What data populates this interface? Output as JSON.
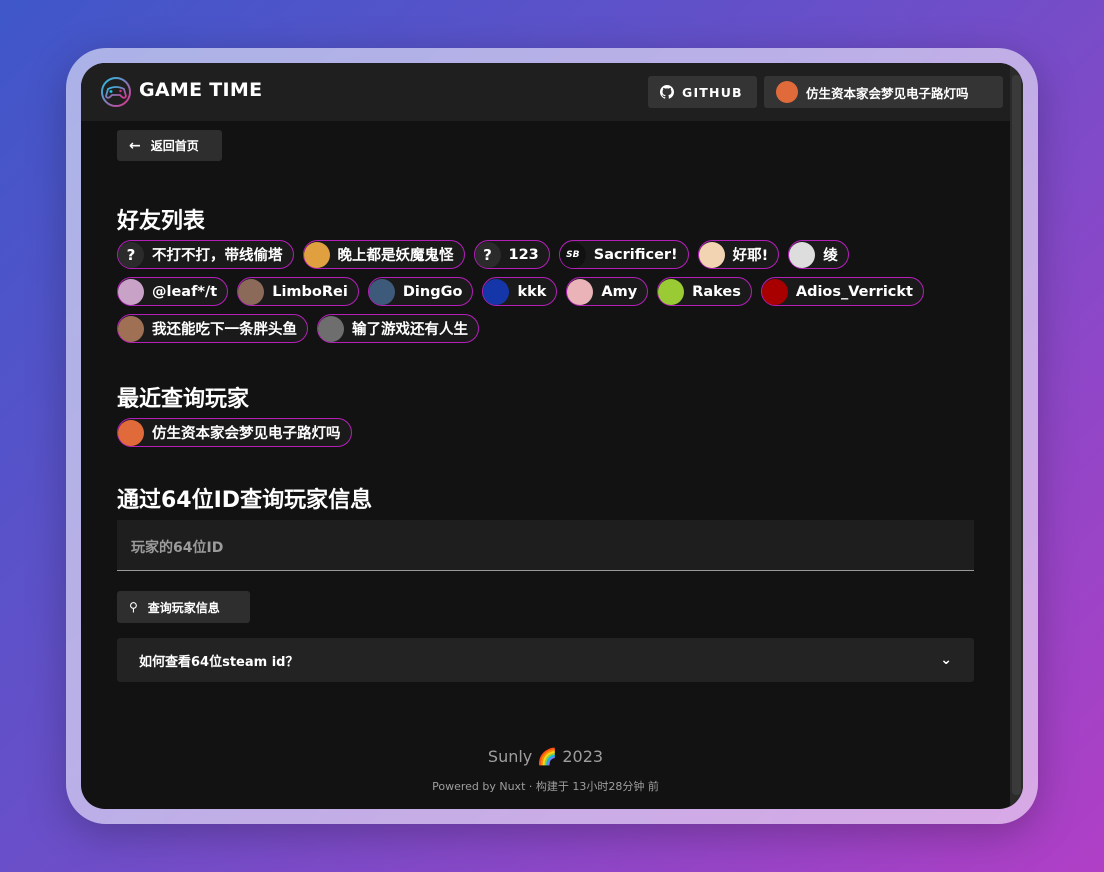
{
  "header": {
    "brand": "GAME TIME",
    "github_label": "GITHUB",
    "user_label": "仿生资本家会梦见电子路灯吗"
  },
  "back_label": "返回首页",
  "friends": {
    "title": "好友列表",
    "items": [
      {
        "name": "不打不打，带线偷塔",
        "avatar": "?",
        "color": "#2b2b2b"
      },
      {
        "name": "晚上都是妖魔鬼怪",
        "avatar": "",
        "color": "#e0a040"
      },
      {
        "name": "123",
        "avatar": "?",
        "color": "#2b2b2b"
      },
      {
        "name": "Sacrificer!",
        "avatar": "SB",
        "color": "#111111"
      },
      {
        "name": "好耶!",
        "avatar": "",
        "color": "#f2d3b2"
      },
      {
        "name": "绫",
        "avatar": "",
        "color": "#dddddd"
      },
      {
        "name": "@leaf*/t",
        "avatar": "",
        "color": "#c9a2c8"
      },
      {
        "name": "LimboRei",
        "avatar": "",
        "color": "#8b6a5a"
      },
      {
        "name": "DingGo",
        "avatar": "",
        "color": "#3e5a7a"
      },
      {
        "name": "kkk",
        "avatar": "",
        "color": "#1436a8"
      },
      {
        "name": "Amy",
        "avatar": "",
        "color": "#e9b3b8"
      },
      {
        "name": "Rakes",
        "avatar": "",
        "color": "#9acb34"
      },
      {
        "name": "Adios_Verrickt",
        "avatar": "",
        "color": "#a80000"
      },
      {
        "name": "我还能吃下一条胖头鱼",
        "avatar": "",
        "color": "#a07055"
      },
      {
        "name": "输了游戏还有人生",
        "avatar": "",
        "color": "#6e6e6e"
      }
    ]
  },
  "recent": {
    "title": "最近查询玩家",
    "items": [
      {
        "name": "仿生资本家会梦见电子路灯吗",
        "avatar": "",
        "color": "#e06a3a"
      }
    ]
  },
  "search": {
    "title": "通过64位ID查询玩家信息",
    "placeholder": "玩家的64位ID",
    "button_label": "查询玩家信息",
    "faq_label": "如何查看64位steam id？"
  },
  "footer": {
    "line1": "Sunly 🌈 2023",
    "line2": "Powered by Nuxt · 构建于 13小时28分钟 前"
  }
}
